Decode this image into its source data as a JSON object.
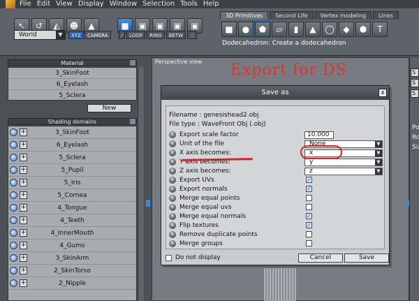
{
  "menubar": {
    "items": [
      "File",
      "Edit",
      "View",
      "Display",
      "Window",
      "Selection",
      "Tools",
      "Help"
    ]
  },
  "toolbar": {
    "left_tools": [
      "pointer-tool",
      "rotate-tool",
      "paint-tool",
      "mannequin-tool",
      "camera-tool"
    ],
    "space_select": "World",
    "xyz_chip": "XYZ",
    "camera_chip": "CAMERA",
    "mini_buttons": [
      "LOOP",
      "RING",
      "BETW"
    ],
    "mode_tools": [
      "object-mode",
      "vertex-mode",
      "edge-mode",
      "face-mode",
      "uv-mode"
    ]
  },
  "prim_tabs": [
    "3D Primitives",
    "Second Life",
    "Vertex modeling",
    "Lines"
  ],
  "primitives": [
    "cube",
    "sphere",
    "dodecahedron",
    "plane",
    "cylinder",
    "cone",
    "ring",
    "octahedron",
    "geosphere",
    "tube"
  ],
  "status": "Dodecahedron: Create a dodecahedron",
  "material_panel": {
    "title": "Material",
    "items": [
      "3_SkinFoot",
      "6_Eyelash",
      "5_Sclera"
    ],
    "new_button": "New"
  },
  "shading_panel": {
    "title": "Shading domains",
    "items": [
      "3_SkinFoot",
      "6_Eyelash",
      "5_Sclera",
      "5_Pupil",
      "5_Iris",
      "5_Cornea",
      "4_Tongue",
      "4_Teeth",
      "4_InnerMouth",
      "4_Gums",
      "3_SkinArm",
      "2_SkinTorso",
      "2_Nipple"
    ]
  },
  "viewport": {
    "label": "Perspective view",
    "annotation": "Export for DS"
  },
  "right_panel": {
    "labels": [
      "Po",
      "Ro",
      "Siz"
    ]
  },
  "dialog": {
    "title": "Save as",
    "close": "x",
    "filename": "Filename : genesishead2.obj",
    "filetype": "File type : WaveFront Obj  (.obj)",
    "options": [
      {
        "label": "Export scale factor",
        "kind": "number",
        "value": "10.000"
      },
      {
        "label": "Unit of the file",
        "kind": "select",
        "value": "None"
      },
      {
        "label": "X axis becomes:",
        "kind": "select",
        "value": "x"
      },
      {
        "label": "Y axis becomes:",
        "kind": "select",
        "value": "y"
      },
      {
        "label": "Z axis becomes:",
        "kind": "select",
        "value": "z"
      },
      {
        "label": "Export UVs",
        "kind": "check",
        "checked": true
      },
      {
        "label": "Export normals",
        "kind": "check",
        "checked": true
      },
      {
        "label": "Merge equal points",
        "kind": "check",
        "checked": false
      },
      {
        "label": "Merge equal uvs",
        "kind": "check",
        "checked": false
      },
      {
        "label": "Merge equal normals",
        "kind": "check",
        "checked": true
      },
      {
        "label": "Flip textures",
        "kind": "check",
        "checked": true
      },
      {
        "label": "Remove duplicate points",
        "kind": "check",
        "checked": false
      },
      {
        "label": "Merge groups",
        "kind": "check",
        "checked": false
      }
    ],
    "do_not_display": "Do not display",
    "cancel": "Cancel",
    "save": "Save"
  },
  "colors": {
    "selection_blue": "#2a61b2",
    "annotation_red": "#e1322f"
  }
}
